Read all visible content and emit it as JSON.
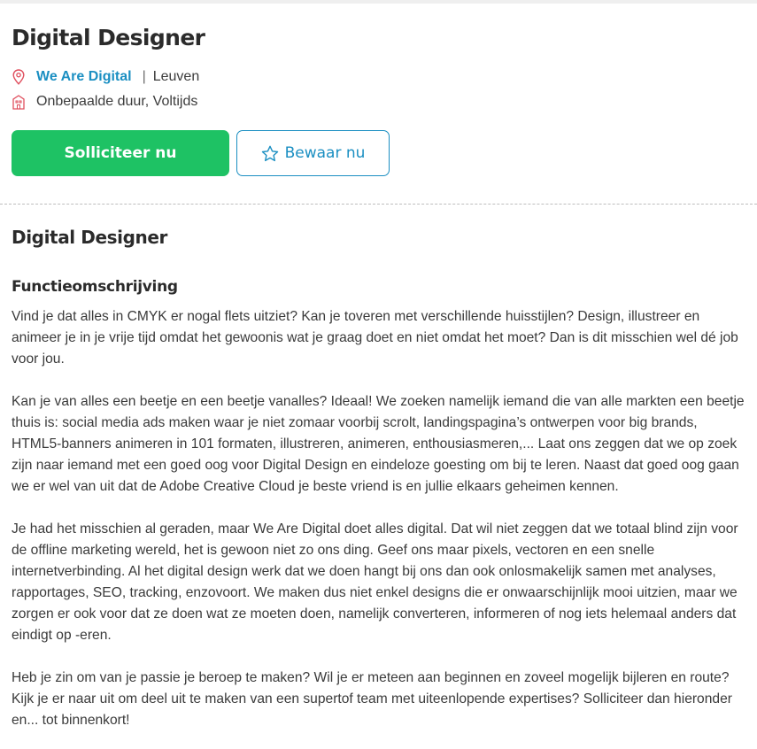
{
  "job": {
    "title": "Digital Designer",
    "company": "We Are Digital",
    "separator": "|",
    "location": "Leuven",
    "contract": "Onbepaalde duur, Voltijds"
  },
  "actions": {
    "apply_label": "Solliciteer nu",
    "save_label": "Bewaar nu"
  },
  "description": {
    "heading": "Digital Designer",
    "subheading": "Functieomschrijving",
    "paragraphs": [
      "Vind je dat alles in CMYK er nogal flets uitziet? Kan je toveren met verschillende huisstijlen? Design, illustreer en animeer je in je vrije tijd omdat het gewoonis wat je graag doet en niet omdat het moet? Dan is dit misschien wel dé job voor jou.",
      "Kan je van alles een beetje en een beetje vanalles? Ideaal! We zoeken namelijk iemand die van alle markten een beetje thuis is: social media ads maken waar je niet zomaar voorbij scrolt, landingspagina’s ontwerpen voor big brands, HTML5-banners animeren in 101 formaten, illustreren, animeren, enthousiasmeren,... Laat ons zeggen dat we op zoek zijn naar iemand met een goed oog voor Digital Design en eindeloze goesting om bij te leren. Naast dat goed oog gaan we er wel van uit dat de Adobe Creative Cloud je beste vriend is en jullie elkaars geheimen kennen.",
      "Je had het misschien al geraden, maar We Are Digital doet alles digital. Dat wil niet zeggen dat we totaal blind zijn voor de offline marketing wereld, het is gewoon niet zo ons ding. Geef ons maar pixels, vectoren en een snelle internetverbinding. Al het digital design werk dat we doen hangt bij ons dan ook onlosmakelijk samen met analyses, rapportages, SEO, tracking, enzovoort. We maken dus niet enkel designs die er onwaarschijnlijk mooi uitzien, maar we zorgen er ook voor dat ze doen wat ze moeten doen, namelijk converteren, informeren of nog iets helemaal anders dat eindigt op -eren.",
      "Heb je zin om van je passie je beroep te maken? Wil je er meteen aan beginnen en zoveel mogelijk bijleren en route? Kijk je er naar uit om deel uit te maken van een supertof team met uiteenlopende expertises? Solliciteer dan hieronder en... tot binnenkort!"
    ]
  },
  "icons": {
    "location": "map-pin-icon",
    "contract": "building-icon",
    "save": "star-icon"
  },
  "colors": {
    "accent_green": "#1ec264",
    "link_blue": "#1b8fc2",
    "icon_red": "#e0505f"
  }
}
